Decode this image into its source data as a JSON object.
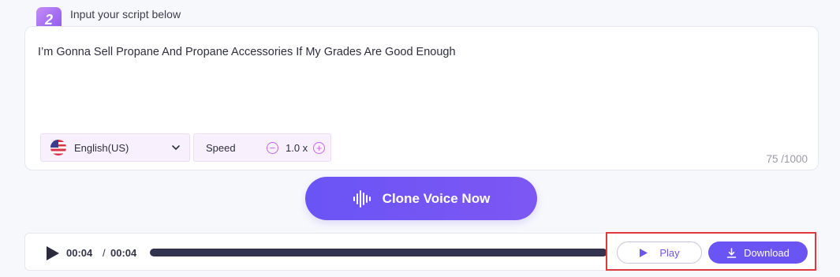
{
  "step": {
    "number": "2",
    "title": "Input your script below"
  },
  "script": {
    "text": "I’m Gonna Sell Propane And Propane Accessories If My Grades Are Good Enough",
    "char_count": "75 /1000"
  },
  "language": {
    "selected": "English(US)",
    "flag_icon": "us-flag-icon"
  },
  "speed": {
    "label": "Speed",
    "value": "1.0 x",
    "decrease_symbol": "−",
    "increase_symbol": "+"
  },
  "clone_button": {
    "label": "Clone Voice Now",
    "icon": "sound-wave-icon"
  },
  "player": {
    "current_time": "00:04",
    "separator": "/",
    "total_time": "00:04",
    "progress": 1.0
  },
  "actions": {
    "play_label": "Play",
    "download_label": "Download"
  },
  "colors": {
    "accent": "#6a55f4",
    "highlight": "#e0393c"
  }
}
